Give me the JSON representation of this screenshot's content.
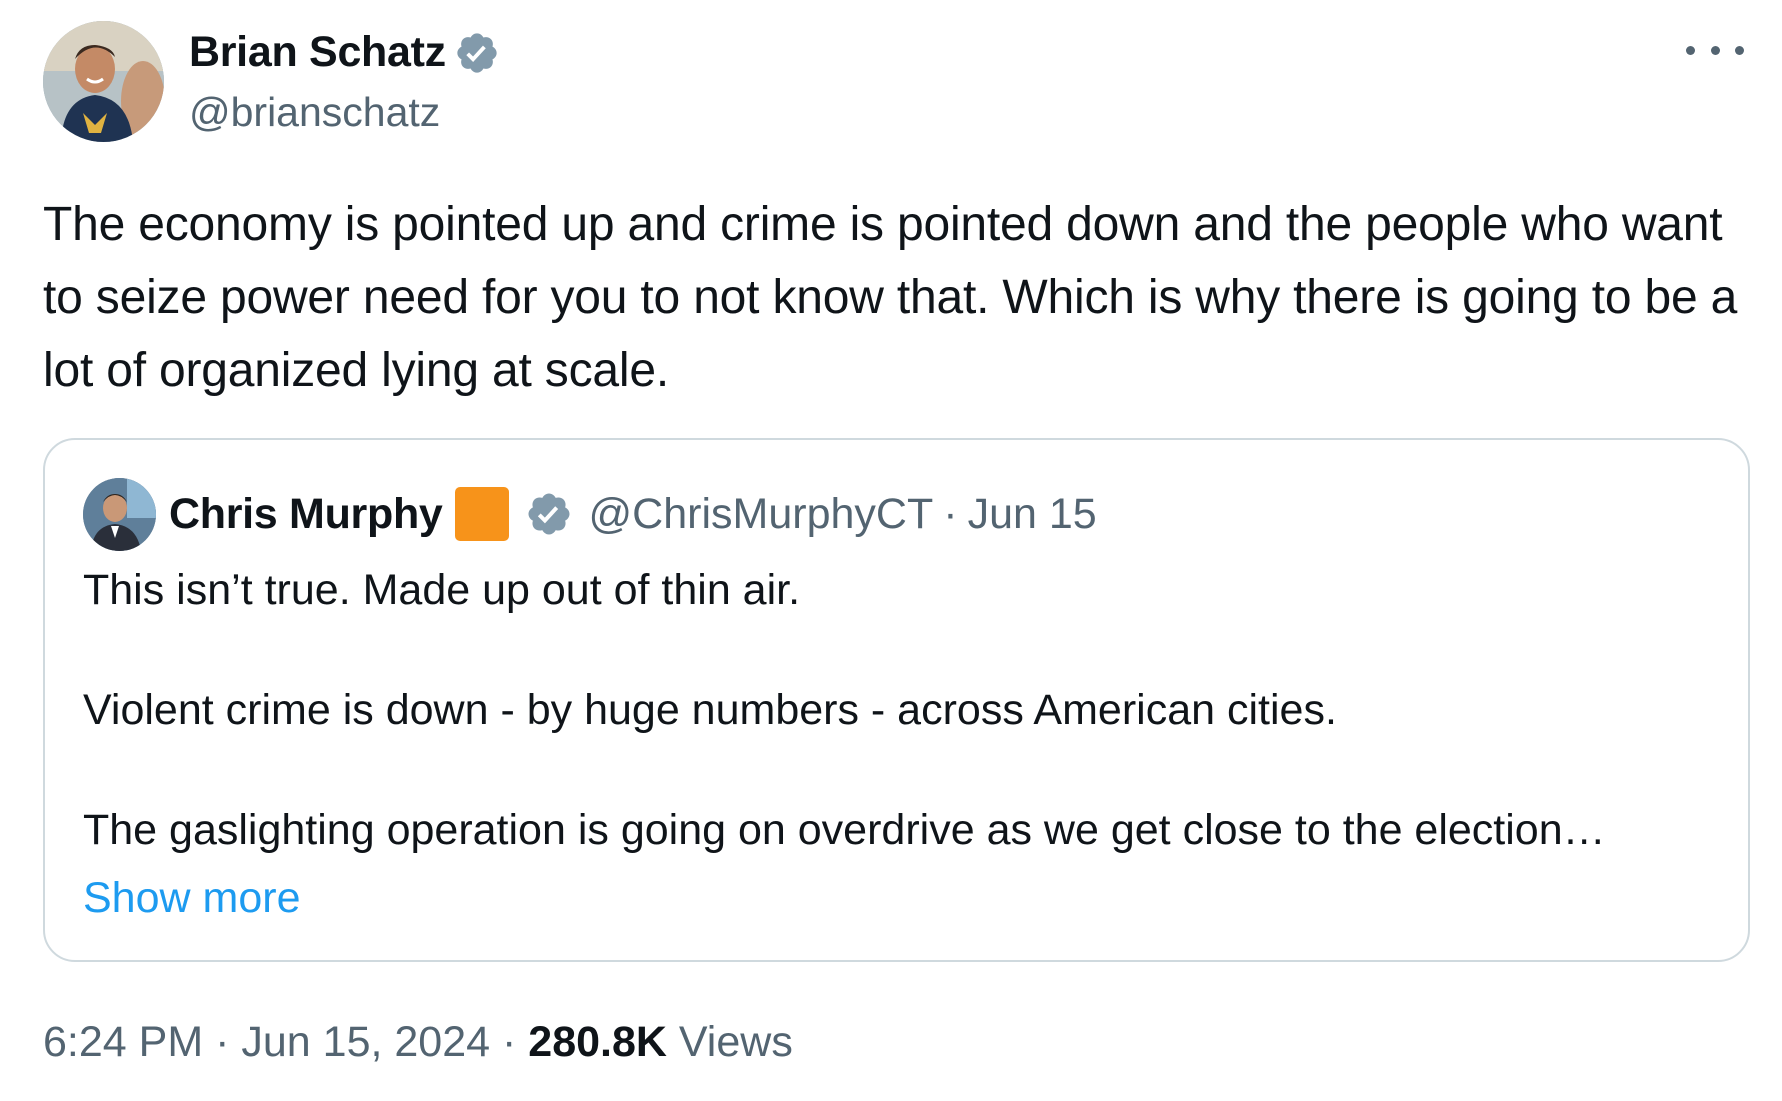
{
  "author": {
    "name": "Brian Schatz",
    "handle": "@brianschatz",
    "verified_icon": "verified-badge-icon"
  },
  "tweet": {
    "text": "The economy is pointed up and crime is pointed down and the people who want to seize power need for you to not know that. Which is why there is going to be a lot of organized lying at scale."
  },
  "quoted": {
    "name": "Chris Murphy",
    "handle": "@ChrisMurphyCT",
    "separator": "·",
    "date": "Jun 15",
    "paragraphs": [
      "This isn’t true. Made up out of thin air.",
      "Violent crime is down - by huge numbers - across American cities.",
      "The gaslighting operation is going on overdrive as we get close to the election…"
    ],
    "show_more": "Show more",
    "affiliation_color": "#f7931a"
  },
  "footer": {
    "time": "6:24 PM",
    "sep1": "·",
    "date": "Jun 15, 2024",
    "sep2": "·",
    "views_count": "280.8K",
    "views_label": "Views"
  },
  "colors": {
    "text": "#0f1419",
    "secondary": "#536471",
    "link": "#1d9bf0",
    "verified": "#829aab",
    "border": "#cfd9de"
  }
}
